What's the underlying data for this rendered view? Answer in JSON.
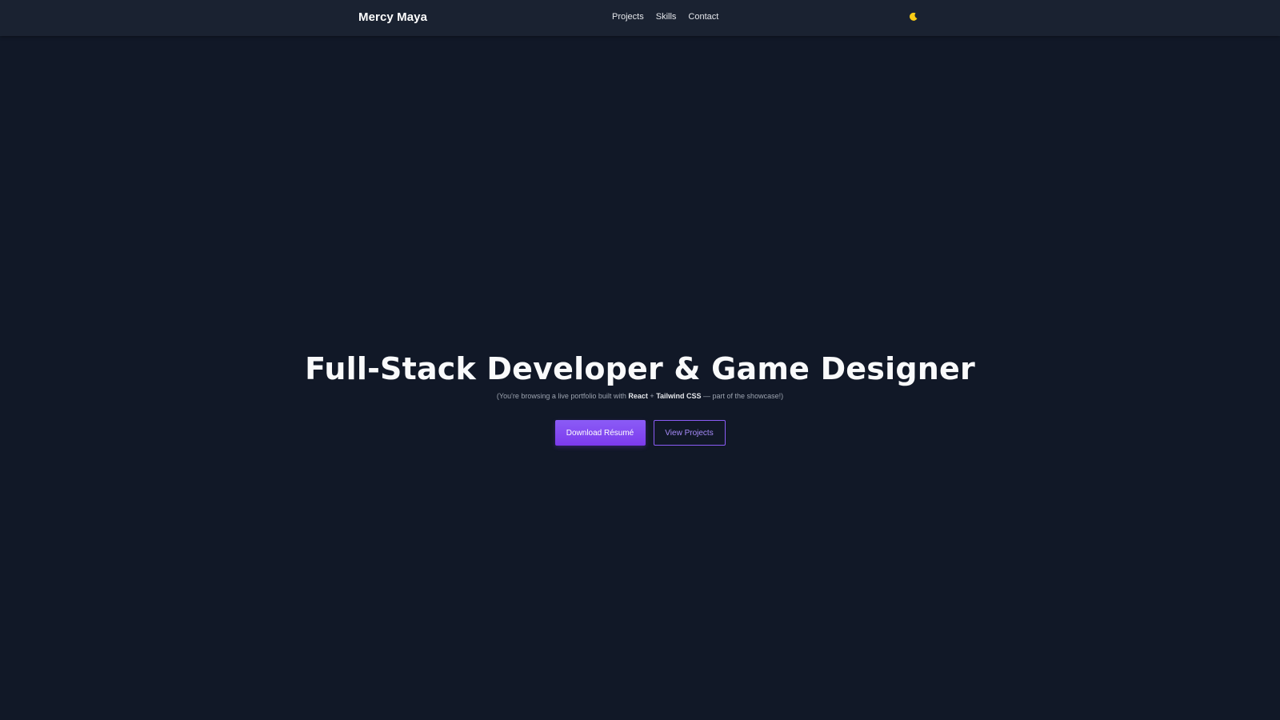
{
  "navbar": {
    "brand": "Mercy Maya",
    "links": [
      {
        "label": "Projects"
      },
      {
        "label": "Skills"
      },
      {
        "label": "Contact"
      }
    ],
    "theme_toggle_icon": "moon-icon"
  },
  "hero": {
    "title": "Full-Stack Developer & Game Designer",
    "subtitle_prefix": "(You're browsing a live portfolio built with ",
    "subtitle_react": "React",
    "subtitle_plus": " + ",
    "subtitle_tailwind": "Tailwind CSS",
    "subtitle_suffix": " — part of the showcase!)"
  },
  "cta": {
    "primary_label": "Download Résumé",
    "secondary_label": "View Projects"
  },
  "colors": {
    "background": "#111827",
    "navbar": "#1a2231",
    "accent": "#7c3aed",
    "accent_light": "#a78bfa",
    "moon": "#facc15"
  }
}
